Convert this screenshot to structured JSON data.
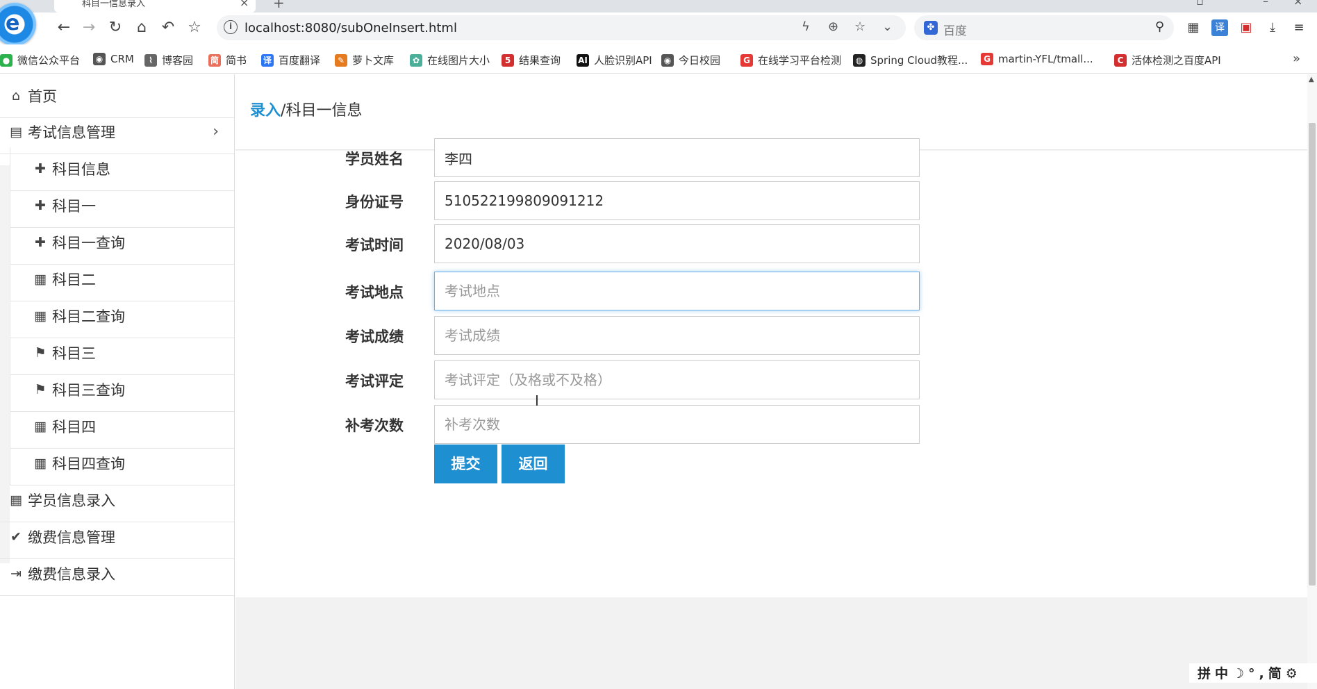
{
  "browser": {
    "tab_title": "科目一信息录入",
    "url": "localhost:8080/subOneInsert.html",
    "search_placeholder": "百度",
    "bookmarks": [
      {
        "label": "微信公众平台",
        "color": "#2bb24c",
        "glyph": "●"
      },
      {
        "label": "CRM",
        "color": "#555555",
        "glyph": "◉"
      },
      {
        "label": "博客园",
        "color": "#666666",
        "glyph": "⌇"
      },
      {
        "label": "简书",
        "color": "#ea6f5a",
        "glyph": "简"
      },
      {
        "label": "百度翻译",
        "color": "#2b76f5",
        "glyph": "译"
      },
      {
        "label": "萝卜文库",
        "color": "#e57a1f",
        "glyph": "✎"
      },
      {
        "label": "在线图片大小",
        "color": "#4caf9a",
        "glyph": "✿"
      },
      {
        "label": "结果查询",
        "color": "#d32f2f",
        "glyph": "5"
      },
      {
        "label": "人脸识别API",
        "color": "#111111",
        "glyph": "AI"
      },
      {
        "label": "今日校园",
        "color": "#555555",
        "glyph": "◉"
      },
      {
        "label": "在线学习平台检测",
        "color": "#e53935",
        "glyph": "G"
      },
      {
        "label": "Spring Cloud教程...",
        "color": "#222222",
        "glyph": "◍"
      },
      {
        "label": "martin-YFL/tmall...",
        "color": "#e53935",
        "glyph": "G"
      },
      {
        "label": "活体检测之百度API",
        "color": "#d32f2f",
        "glyph": "C"
      }
    ]
  },
  "sidebar": {
    "items": [
      {
        "label": "首页",
        "icon": "home-icon",
        "glyph": "⌂",
        "level": "top"
      },
      {
        "label": "考试信息管理",
        "icon": "file-icon",
        "glyph": "▤",
        "level": "top",
        "expanded": true
      },
      {
        "label": "科目信息",
        "icon": "puzzle-icon",
        "glyph": "✚",
        "level": "sub"
      },
      {
        "label": "科目一",
        "icon": "puzzle-icon",
        "glyph": "✚",
        "level": "sub"
      },
      {
        "label": "科目一查询",
        "icon": "puzzle-icon",
        "glyph": "✚",
        "level": "sub"
      },
      {
        "label": "科目二",
        "icon": "grid-icon",
        "glyph": "▦",
        "level": "sub"
      },
      {
        "label": "科目二查询",
        "icon": "grid-icon",
        "glyph": "▦",
        "level": "sub"
      },
      {
        "label": "科目三",
        "icon": "flag-icon",
        "glyph": "⚑",
        "level": "sub"
      },
      {
        "label": "科目三查询",
        "icon": "flag-icon",
        "glyph": "⚑",
        "level": "sub"
      },
      {
        "label": "科目四",
        "icon": "calendar-icon",
        "glyph": "▦",
        "level": "sub"
      },
      {
        "label": "科目四查询",
        "icon": "calendar-icon",
        "glyph": "▦",
        "level": "sub"
      },
      {
        "label": "学员信息录入",
        "icon": "table-icon",
        "glyph": "▦",
        "level": "top"
      },
      {
        "label": "缴费信息管理",
        "icon": "check-icon",
        "glyph": "✔",
        "level": "top"
      },
      {
        "label": "缴费信息录入",
        "icon": "sign-in-icon",
        "glyph": "⇥",
        "level": "top"
      }
    ]
  },
  "breadcrumb": {
    "link": "录入",
    "separator": "/",
    "current": "科目一信息"
  },
  "form": {
    "fields": [
      {
        "label": "学员姓名",
        "value": "李四",
        "placeholder": "学员姓名"
      },
      {
        "label": "身份证号",
        "value": "510522199809091212",
        "placeholder": "身份证号"
      },
      {
        "label": "考试时间",
        "value": "2020/08/03",
        "placeholder": "考试时间"
      },
      {
        "label": "考试地点",
        "value": "",
        "placeholder": "考试地点",
        "focused": true
      },
      {
        "label": "考试成绩",
        "value": "",
        "placeholder": "考试成绩"
      },
      {
        "label": "考试评定",
        "value": "",
        "placeholder": "考试评定（及格或不及格）"
      },
      {
        "label": "补考次数",
        "value": "",
        "placeholder": "补考次数"
      }
    ],
    "submit_label": "提交",
    "back_label": "返回"
  },
  "ime": {
    "text": "拼中☽°,简⚙"
  },
  "colors": {
    "accent": "#1e90d2",
    "focus_border": "#66afe9"
  }
}
